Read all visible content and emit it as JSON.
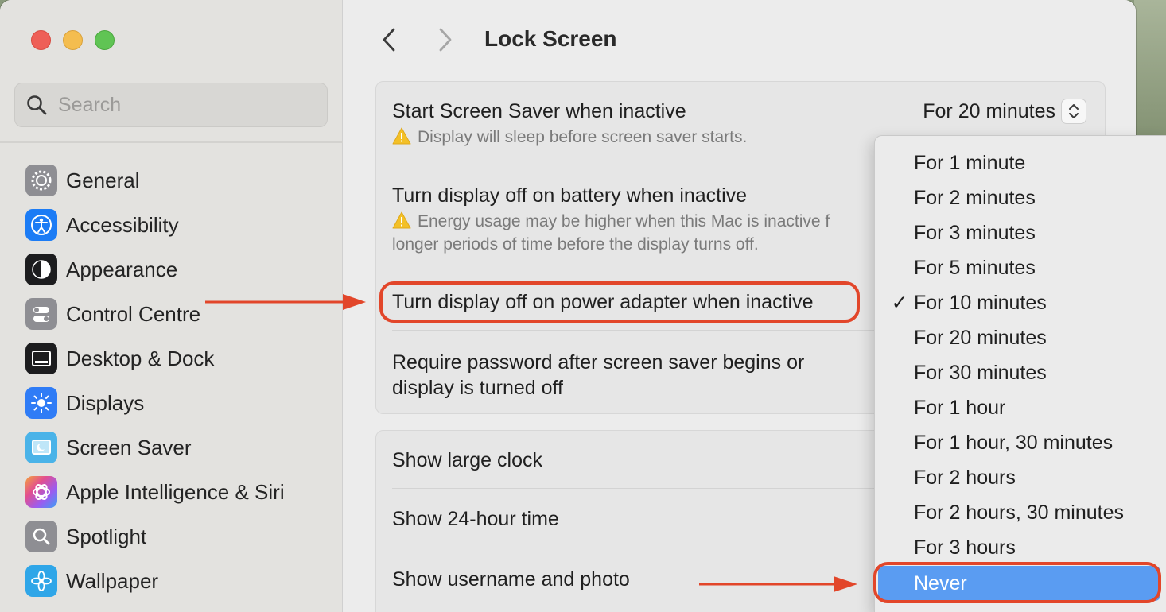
{
  "colors": {
    "accent_selected": "#5a9cf2",
    "annotation": "#e2462a",
    "warning": "#f3c027"
  },
  "sidebar": {
    "search_placeholder": "Search",
    "items": [
      {
        "label": "General",
        "icon": "gear-icon",
        "color": "#8e8e93"
      },
      {
        "label": "Accessibility",
        "icon": "accessibility-icon",
        "color": "#1c7cf5"
      },
      {
        "label": "Appearance",
        "icon": "appearance-icon",
        "color": "#1c1c1e"
      },
      {
        "label": "Control Centre",
        "icon": "control-centre-icon",
        "color": "#8e8e93"
      },
      {
        "label": "Desktop & Dock",
        "icon": "dock-icon",
        "color": "#1c1c1e"
      },
      {
        "label": "Displays",
        "icon": "sun-icon",
        "color": "#2f7cf6"
      },
      {
        "label": "Screen Saver",
        "icon": "screen-saver-icon",
        "color": "#4ab3e8"
      },
      {
        "label": "Apple Intelligence & Siri",
        "icon": "siri-icon",
        "color": "#d05bd4"
      },
      {
        "label": "Spotlight",
        "icon": "spotlight-icon",
        "color": "#8e8e93"
      },
      {
        "label": "Wallpaper",
        "icon": "wallpaper-icon",
        "color": "#2fa6e8"
      }
    ]
  },
  "header": {
    "title": "Lock Screen"
  },
  "settings": {
    "screen_saver": {
      "title": "Start Screen Saver when inactive",
      "warning": "Display will sleep before screen saver starts.",
      "value": "For 20 minutes"
    },
    "battery": {
      "title": "Turn display off on battery when inactive",
      "warning_line1": "Energy usage may be higher when this Mac is inactive f",
      "warning_line2": "longer periods of time before the display turns off."
    },
    "power_adapter": {
      "title": "Turn display off on power adapter when inactive"
    },
    "password": {
      "title_line1": "Require password after screen saver begins or",
      "title_line2": "display is turned off"
    },
    "clock": {
      "title": "Show large clock"
    },
    "hour24": {
      "title": "Show 24-hour time"
    },
    "username": {
      "title": "Show username and photo"
    }
  },
  "menu": {
    "items": [
      {
        "label": "For 1 minute",
        "checked": false
      },
      {
        "label": "For 2 minutes",
        "checked": false
      },
      {
        "label": "For 3 minutes",
        "checked": false
      },
      {
        "label": "For 5 minutes",
        "checked": false
      },
      {
        "label": "For 10 minutes",
        "checked": true
      },
      {
        "label": "For 20 minutes",
        "checked": false
      },
      {
        "label": "For 30 minutes",
        "checked": false
      },
      {
        "label": "For 1 hour",
        "checked": false
      },
      {
        "label": "For 1 hour, 30 minutes",
        "checked": false
      },
      {
        "label": "For 2 hours",
        "checked": false
      },
      {
        "label": "For 2 hours, 30 minutes",
        "checked": false
      },
      {
        "label": "For 3 hours",
        "checked": false
      },
      {
        "label": "Never",
        "checked": false,
        "highlighted": true
      }
    ],
    "check_glyph": "✓"
  }
}
